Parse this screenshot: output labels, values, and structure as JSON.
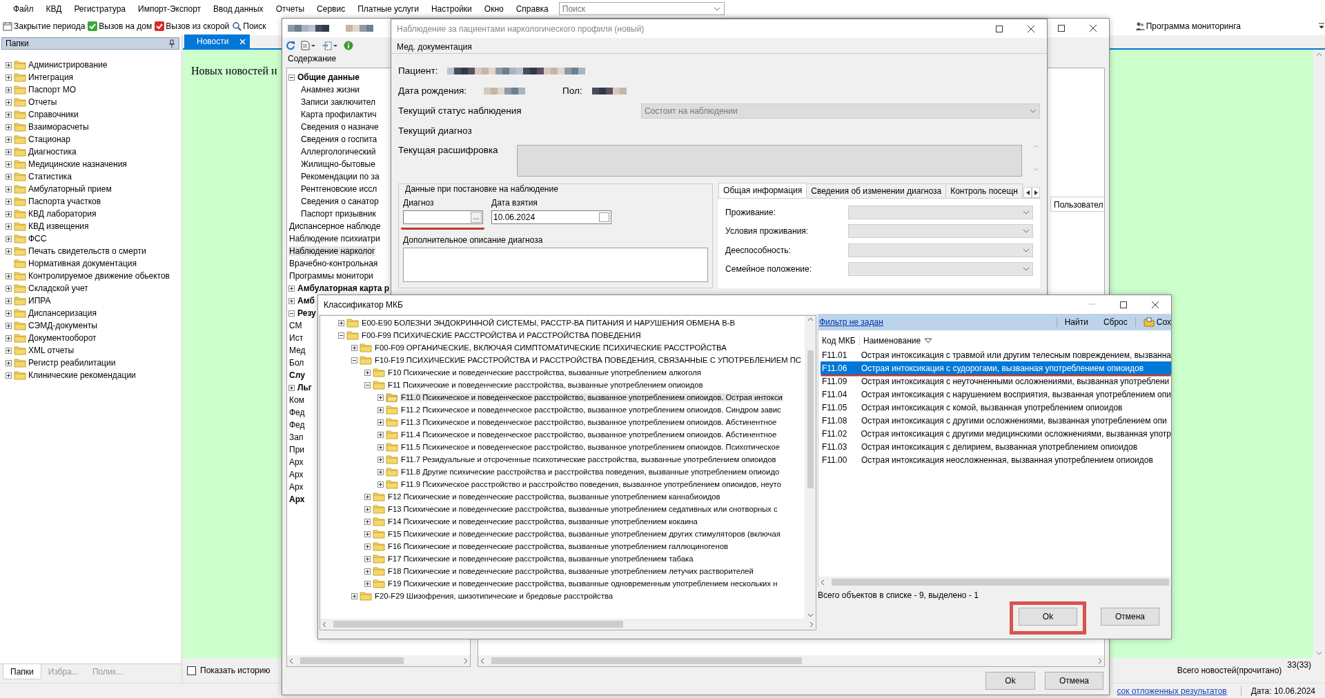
{
  "menu": [
    "Файл",
    "КВД",
    "Регистратура",
    "Импорт-Экспорт",
    "Ввод данных",
    "Отчеты",
    "Сервис",
    "Платные услуги",
    "Настройки",
    "Окно",
    "Справка"
  ],
  "search": {
    "placeholder": "Поиск"
  },
  "toolbar": [
    {
      "label": "Закрытие периода"
    },
    {
      "label": "Вызов на дом"
    },
    {
      "label": "Вызов из скорой"
    },
    {
      "label": "Поиск"
    }
  ],
  "toolbar_right": {
    "label": "Программа мониторинга"
  },
  "folders_panel": {
    "title": "Папки",
    "items": [
      {
        "label": "Администрирование",
        "expanded": false
      },
      {
        "label": "Интеграция",
        "expanded": false
      },
      {
        "label": "Паспорт МО",
        "expanded": false
      },
      {
        "label": "Отчеты",
        "expanded": false
      },
      {
        "label": "Справочники",
        "expanded": false
      },
      {
        "label": "Взаиморасчеты",
        "expanded": false
      },
      {
        "label": "Стационар",
        "expanded": false
      },
      {
        "label": "Диагностика",
        "expanded": false
      },
      {
        "label": "Медицинские назначения",
        "expanded": false
      },
      {
        "label": "Статистика",
        "expanded": false
      },
      {
        "label": "Амбулаторный прием",
        "expanded": false
      },
      {
        "label": "Паспорта участков",
        "expanded": false
      },
      {
        "label": "КВД лаборатория",
        "expanded": false
      },
      {
        "label": "КВД извещения",
        "expanded": false
      },
      {
        "label": "ФСС",
        "expanded": false
      },
      {
        "label": "Печать свидетельств о смерти",
        "expanded": false
      },
      {
        "label": "Нормативная документация"
      },
      {
        "label": "Контролируемое движение обьектов",
        "expanded": false
      },
      {
        "label": "Складской учет",
        "expanded": false
      },
      {
        "label": "ИПРА",
        "expanded": false
      },
      {
        "label": "Диспансеризация",
        "expanded": false
      },
      {
        "label": "СЭМД-документы",
        "expanded": false
      },
      {
        "label": "Документооборот",
        "expanded": false
      },
      {
        "label": "XML отчеты",
        "expanded": false
      },
      {
        "label": "Регистр реабилитации",
        "expanded": false
      },
      {
        "label": "Клинические рекомендации",
        "expanded": false
      }
    ],
    "tabs": [
      {
        "label": "Папки",
        "selected": true
      },
      {
        "label": "Избра...",
        "selected": false
      },
      {
        "label": "Полик...",
        "selected": false
      }
    ]
  },
  "news_tab": {
    "label": "Новости"
  },
  "news": {
    "message": "Новых новостей н",
    "show_history": {
      "label": "Показать историю",
      "checked": false
    },
    "total_label": "Всего новостей(прочитано)",
    "total_count": "33(33)"
  },
  "status_bar": {
    "link": "сок отложенных результатов",
    "date": "Дата: 10.06.2024"
  },
  "med_window": {
    "title_hidden": true,
    "contents_label": "Содержание",
    "tree": [
      {
        "label": "Общие данные",
        "kind": "group",
        "expanded": true,
        "selected": false,
        "children": [
          {
            "label": "Анамнез жизни",
            "selected": false
          },
          {
            "label": "Записи заключител",
            "selected": false
          },
          {
            "label": "Карта профилактич",
            "selected": false
          },
          {
            "label": "Сведения о назначе",
            "selected": false
          },
          {
            "label": "Сведения о госпита",
            "selected": false
          },
          {
            "label": "Аллергологический",
            "selected": false
          },
          {
            "label": "Жилищно-бытовые",
            "selected": false
          },
          {
            "label": "Рекомендации по за",
            "selected": false
          },
          {
            "label": "Рентгеновские иссл",
            "selected": false
          },
          {
            "label": "Сведения о санатор",
            "selected": false
          },
          {
            "label": "Паспорт призывник",
            "selected": false
          }
        ]
      },
      {
        "label": "Диспансерное наблюде",
        "kind": "entry",
        "selected": false
      },
      {
        "label": "Наблюдение психиатри",
        "kind": "entry",
        "selected": false
      },
      {
        "label": "Наблюдение нарколог",
        "kind": "entry",
        "selected": true
      },
      {
        "label": "Врачебно-контрольная",
        "kind": "entry",
        "selected": false
      },
      {
        "label": "Программы монитори",
        "kind": "entry",
        "selected": false
      },
      {
        "label": "Амбулаторная карта р",
        "kind": "group",
        "expanded": false,
        "selected": false
      },
      {
        "label": "Амб",
        "kind": "group",
        "expanded": false,
        "selected": false
      },
      {
        "label": "Резу",
        "kind": "group",
        "expanded": true,
        "selected": false
      },
      {
        "label": "СМ",
        "kind": "entry",
        "selected": false
      },
      {
        "label": "Ист",
        "kind": "entry",
        "selected": false
      },
      {
        "label": "Мед",
        "kind": "entry",
        "selected": false
      },
      {
        "label": "Бол",
        "kind": "entry",
        "selected": false
      },
      {
        "label": "Слу",
        "kind": "group",
        "selected": false
      },
      {
        "label": "Льг",
        "kind": "group",
        "expanded": false,
        "selected": false
      },
      {
        "label": "Ком",
        "kind": "entry",
        "selected": false
      },
      {
        "label": "Фед",
        "kind": "entry",
        "selected": false
      },
      {
        "label": "Фед",
        "kind": "entry",
        "selected": false
      },
      {
        "label": "Зап",
        "kind": "entry",
        "selected": false
      },
      {
        "label": "При",
        "kind": "entry",
        "selected": false
      },
      {
        "label": "Арх",
        "kind": "entry",
        "selected": false
      },
      {
        "label": "Арх",
        "kind": "entry",
        "selected": false
      },
      {
        "label": "Арх",
        "kind": "entry",
        "selected": false
      },
      {
        "label": "Арх",
        "kind": "group",
        "selected": false
      }
    ],
    "side_tab": "Пользовател",
    "buttons": [
      "Ok",
      "Отмена"
    ]
  },
  "observation_dialog": {
    "title": "Наблюдение за пациентами наркологического профиля (новый)",
    "subtitle": "Мед. документация",
    "patient": {
      "label": "Пациент:",
      "value_hidden": true
    },
    "birth_date": {
      "label": "Дата рождения:",
      "value_hidden": true
    },
    "sex": {
      "label": "Пол:",
      "value_hidden": true
    },
    "status": {
      "label": "Текущий статус наблюдения",
      "value": "Состоит на наблюдении",
      "disabled": true
    },
    "current_diagnosis": {
      "label": "Текущий диагноз"
    },
    "decoding": {
      "label": "Текущая расшифровка",
      "disabled": true
    },
    "group": {
      "title": "Данные при постановке на наблюдение",
      "diagnosis": {
        "label": "Диагноз",
        "button": "...",
        "highlighted": true
      },
      "date": {
        "label": "Дата взятия",
        "value": "10.06.2024"
      },
      "extra": {
        "label": "Дополнительное описание диагноза"
      }
    },
    "tabs": [
      {
        "label": "Общая информация",
        "selected": true
      },
      {
        "label": "Сведения об изменении диагноза",
        "selected": false
      },
      {
        "label": "Контроль посещн",
        "selected": false
      }
    ],
    "fields": [
      "Проживание:",
      "Условия проживания:",
      "Дееспособность:",
      "Семейное положение:"
    ]
  },
  "mkb_dialog": {
    "title": "Классификатор МКБ",
    "tree": [
      {
        "label": "E00-E90 БОЛЕЗНИ ЭНДОКРИННОЙ СИСТЕМЫ, РАССТР-ВА ПИТАНИЯ И НАРУШЕНИЯ ОБМЕНА В-В",
        "expanded": false,
        "selected": false
      },
      {
        "label": "F00-F99 ПСИХИЧЕСКИЕ РАССТРОЙСТВА И РАССТРОЙСТВА ПОВЕДЕНИЯ",
        "expanded": true,
        "selected": false,
        "children": [
          {
            "label": "F00-F09 ОРГАНИЧЕСКИЕ, ВКЛЮЧАЯ СИМПТОМАТИЧЕСКИЕ ПСИХИЧЕСКИЕ РАССТРОЙСТВА",
            "expanded": false,
            "selected": false
          },
          {
            "label": "F10-F19 ПСИХИЧЕСКИЕ РАССТРОЙСТВА И РАССТРОЙСТВА ПОВЕДЕНИЯ, СВЯЗАННЫЕ С УПОТРЕБЛЕНИЕМ ПС",
            "expanded": true,
            "selected": false,
            "children": [
              {
                "label": "F10 Психические и поведенческие расстройства, вызванные употреблением алкоголя",
                "expanded": false,
                "selected": false
              },
              {
                "label": "F11 Психические и поведенческие расстройства, вызванные употреблением опиоидов",
                "expanded": true,
                "selected": false,
                "children": [
                  {
                    "label": "F11.0 Психическое и поведенческое расстройство, вызванное употреблением опиоидов. Острая интокси",
                    "expanded": false,
                    "selected": true
                  },
                  {
                    "label": "F11.2 Психическое и поведенческое расстройство, вызванное употреблением опиоидов. Синдром завис",
                    "expanded": false,
                    "selected": false
                  },
                  {
                    "label": "F11.3 Психическое и поведенческое расстройство, вызванное употреблением опиоидов. Абстинентное",
                    "expanded": false,
                    "selected": false
                  },
                  {
                    "label": "F11.4 Психическое и поведенческое расстройство, вызванное употреблением опиоидов. Абстинентное",
                    "expanded": false,
                    "selected": false
                  },
                  {
                    "label": "F11.5 Психическое и поведенческое расстройство, вызванное употреблением опиоидов. Психотическое",
                    "expanded": false,
                    "selected": false
                  },
                  {
                    "label": "F11.7 Резидуальные и отсроченные психотические расстройства, вызванные употреблением опиоидов",
                    "expanded": false,
                    "selected": false
                  },
                  {
                    "label": "F11.8 Другие психические расстройства и расстройства поведения, вызванные употреблением опиоидо",
                    "expanded": false,
                    "selected": false
                  },
                  {
                    "label": "F11.9 Психическое расстройство и расстройство поведения, вызванное употреблением опиоидов, неуто",
                    "expanded": false,
                    "selected": false
                  }
                ]
              },
              {
                "label": "F12 Психические и поведенческие расстройства, вызванные употреблением каннабиоидов",
                "expanded": false,
                "selected": false
              },
              {
                "label": "F13 Психические и поведенческие расстройства, вызванные употреблением седативных или снотворных с",
                "expanded": false,
                "selected": false
              },
              {
                "label": "F14 Психические и поведенческие расстройства, вызванные употреблением кокаина",
                "expanded": false,
                "selected": false
              },
              {
                "label": "F15 Психические и поведенческие расстройства, вызванные употреблением других стимуляторов (включая",
                "expanded": false,
                "selected": false
              },
              {
                "label": "F16 Психические и поведенческие расстройства, вызванные употреблением галлюциногенов",
                "expanded": false,
                "selected": false
              },
              {
                "label": "F17 Психические и поведенческие расстройства, вызванные употреблением табака",
                "expanded": false,
                "selected": false
              },
              {
                "label": "F18 Психические и поведенческие расстройства, вызванные употреблением летучих растворителей",
                "expanded": false,
                "selected": false
              },
              {
                "label": "F19 Психические и поведенческие расстройства, вызванные одновременным употреблением нескольких н",
                "expanded": false,
                "selected": false
              }
            ]
          },
          {
            "label": "F20-F29 Шизофрения, шизотипические и бредовые расстройства",
            "expanded": false,
            "selected": false
          }
        ]
      }
    ],
    "filter": {
      "link": "Фильтр не задан",
      "actions": [
        "Найти",
        "Сброс",
        "Сох"
      ]
    },
    "columns": [
      "Код МКБ",
      "Наименование"
    ],
    "rows": [
      {
        "code": "F11.01",
        "name": "Острая интоксикация с травмой или другим телесным повреждением, вызванна",
        "selected": false
      },
      {
        "code": "F11.06",
        "name": "Острая интоксикация с судорогами, вызванная употреблением опиоидов",
        "selected": true,
        "highlighted": true
      },
      {
        "code": "F11.09",
        "name": "Острая интоксикация с неуточненными осложнениями, вызванная употреблени",
        "selected": false
      },
      {
        "code": "F11.04",
        "name": "Острая интоксикация с нарушением восприятия, вызванная употреблением опи",
        "selected": false
      },
      {
        "code": "F11.05",
        "name": "Острая интоксикация с комой, вызванная употреблением опиоидов",
        "selected": false
      },
      {
        "code": "F11.08",
        "name": "Острая интоксикация с другими осложнениями, вызванная употреблением опи",
        "selected": false
      },
      {
        "code": "F11.02",
        "name": "Острая интоксикация с другими медицинскими осложнениями, вызванная употр",
        "selected": false
      },
      {
        "code": "F11.03",
        "name": "Острая интоксикация с делирием, вызванная употреблением опиоидов",
        "selected": false
      },
      {
        "code": "F11.00",
        "name": "Острая интоксикация неосложненная, вызванная употреблением опиоидов",
        "selected": false
      }
    ],
    "summary": "Всего объектов в списке - 9, выделено - 1",
    "buttons": [
      {
        "label": "Ok",
        "highlighted": true
      },
      {
        "label": "Отмена"
      }
    ]
  }
}
